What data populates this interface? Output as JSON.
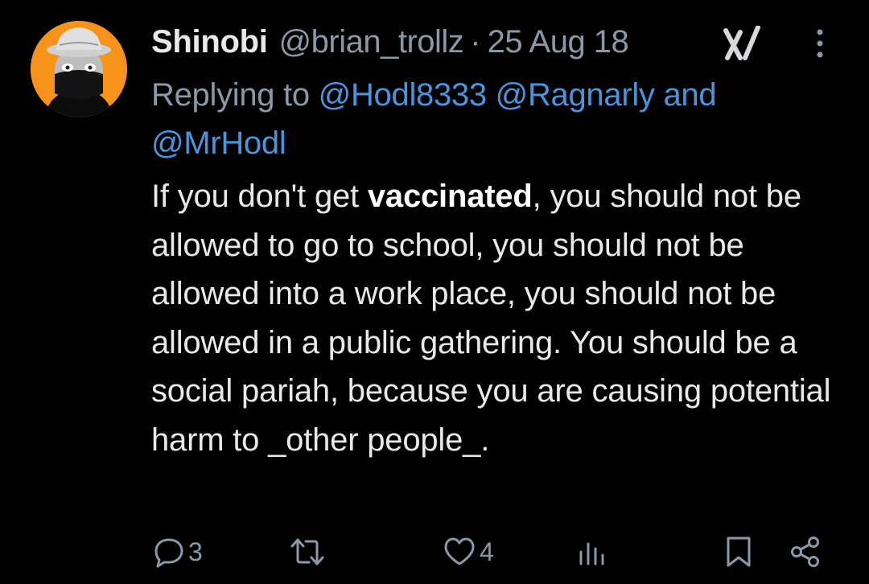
{
  "tweet": {
    "author": {
      "display_name": "Shinobi",
      "handle": "@brian_trollz",
      "avatar_icon": "masked-person-avatar",
      "avatar_bg": "#f7931a"
    },
    "separator": "·",
    "date": "25 Aug 18",
    "reply": {
      "prefix": "Replying to",
      "mentions": [
        "@Hodl8333",
        "@Ragnarly",
        "@MrHodl"
      ],
      "conjunction": "and"
    },
    "text": {
      "part1": "If you don't get ",
      "bold": "vaccinated",
      "part2": ", you should not be allowed to go to school, you should not be allowed into a work place, you should not be allowed in a public gathering. You should be a social pariah, because you are causing potential harm to _other people_."
    },
    "actions": {
      "reply_count": "3",
      "retweet_count": "",
      "like_count": "4"
    },
    "icons": [
      "grok-icon",
      "more-icon",
      "reply-icon",
      "retweet-icon",
      "like-icon",
      "views-icon",
      "bookmark-icon",
      "share-icon"
    ],
    "colors": {
      "background": "#000000",
      "text": "#e7e9ea",
      "muted": "#8b98a5",
      "link": "#4a94db"
    }
  }
}
